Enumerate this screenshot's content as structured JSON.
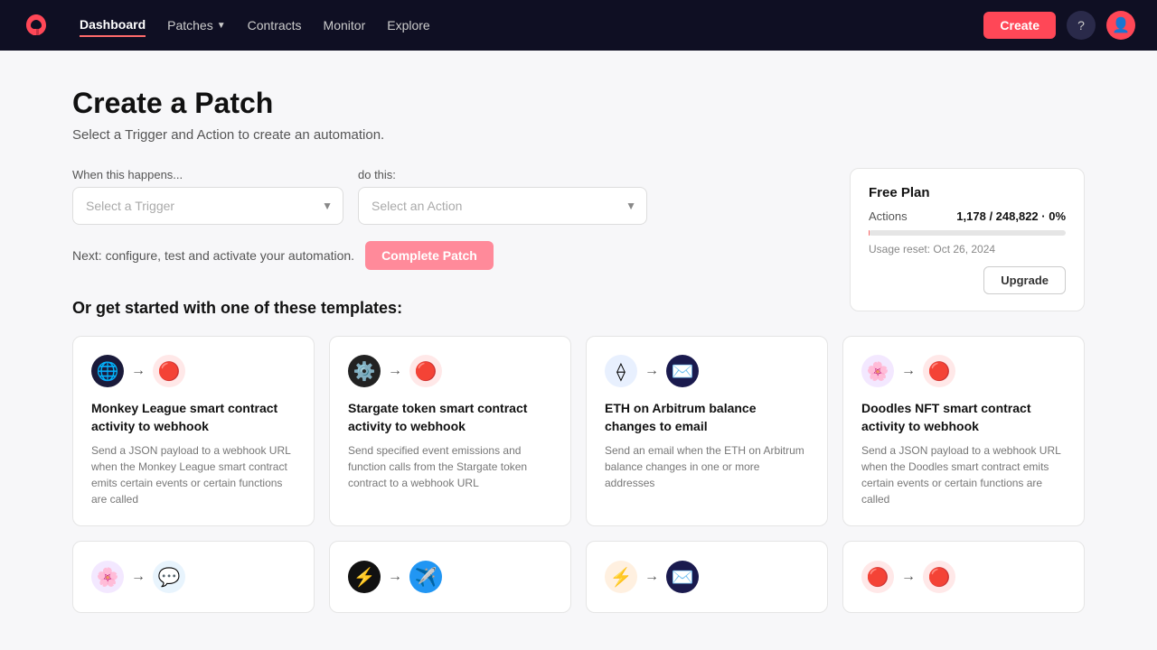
{
  "nav": {
    "logo_alt": "Patch logo",
    "links": [
      {
        "id": "dashboard",
        "label": "Dashboard",
        "active": true
      },
      {
        "id": "patches",
        "label": "Patches",
        "has_dropdown": true
      },
      {
        "id": "contracts",
        "label": "Contracts"
      },
      {
        "id": "monitor",
        "label": "Monitor"
      },
      {
        "id": "explore",
        "label": "Explore"
      }
    ],
    "create_label": "Create",
    "help_icon": "?",
    "user_icon": "👤"
  },
  "main": {
    "title": "Create a Patch",
    "subtitle": "Select a Trigger and Action to create an automation.",
    "when_label": "When this happens...",
    "do_label": "do this:",
    "trigger_placeholder": "Select a Trigger",
    "action_placeholder": "Select an Action",
    "next_text": "Next: configure, test and activate your automation.",
    "complete_patch_label": "Complete Patch",
    "free_plan": {
      "title": "Free Plan",
      "actions_label": "Actions",
      "actions_value": "1,178 / 248,822 · 0%",
      "usage_reset": "Usage reset: Oct 26, 2024",
      "upgrade_label": "Upgrade",
      "progress_percent": 0.5
    },
    "templates_heading": "Or get started with one of these templates:",
    "templates": [
      {
        "id": "monkey-league",
        "trigger_icon": "🌐",
        "trigger_bg": "icon-bg-blue",
        "action_icon": "🔴",
        "action_bg": "icon-bg-red",
        "title": "Monkey League smart contract activity to webhook",
        "desc": "Send a JSON payload to a webhook URL when the Monkey League smart contract emits certain events or certain functions are called"
      },
      {
        "id": "stargate",
        "trigger_icon": "⚙️",
        "trigger_bg": "icon-bg-dark",
        "action_icon": "🔴",
        "action_bg": "icon-bg-red",
        "title": "Stargate token smart contract activity to webhook",
        "desc": "Send specified event emissions and function calls from the Stargate token contract to a webhook URL"
      },
      {
        "id": "eth-arbitrum",
        "trigger_icon": "⟠",
        "trigger_bg": "icon-bg-eth",
        "action_icon": "✉️",
        "action_bg": "icon-bg-blue",
        "title": "ETH on Arbitrum balance changes to email",
        "desc": "Send an email when the ETH on Arbitrum balance changes in one or more addresses"
      },
      {
        "id": "doodles",
        "trigger_icon": "🌸",
        "trigger_bg": "icon-bg-purple",
        "action_icon": "🔴",
        "action_bg": "icon-bg-red",
        "title": "Doodles NFT smart contract activity to webhook",
        "desc": "Send a JSON payload to a webhook URL when the Doodles smart contract emits certain events or certain functions are called"
      }
    ],
    "templates_bottom": [
      {
        "id": "bottom-1",
        "trigger_icon": "🌸",
        "trigger_bg": "icon-bg-purple",
        "action_icon": "💬",
        "action_bg": "icon-bg-blue"
      },
      {
        "id": "bottom-2",
        "trigger_icon": "⚡",
        "trigger_bg": "icon-bg-dark",
        "action_icon": "✈️",
        "action_bg": "icon-bg-blue"
      },
      {
        "id": "bottom-3",
        "trigger_icon": "⚡",
        "trigger_bg": "icon-bg-orange",
        "action_icon": "✉️",
        "action_bg": "icon-bg-blue"
      },
      {
        "id": "bottom-4",
        "trigger_icon": "🔴",
        "trigger_bg": "icon-bg-red",
        "action_icon": "🔴",
        "action_bg": "icon-bg-red"
      }
    ]
  }
}
